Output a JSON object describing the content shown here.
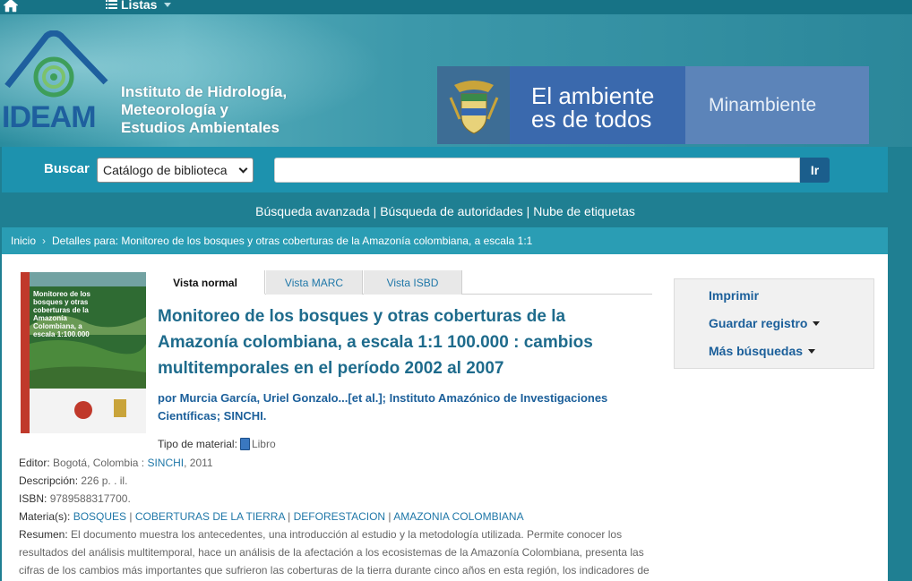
{
  "topbar": {
    "lists_label": "Listas"
  },
  "banner": {
    "logo_text": "IDEAM",
    "institute_lines": [
      "Instituto de Hidrología,",
      "Meteorología y",
      "Estudios Ambientales"
    ],
    "gov_slogan_lines": [
      "El ambiente",
      "es de todos"
    ],
    "ministry": "Minambiente"
  },
  "search": {
    "label": "Buscar",
    "selected_option": "Catálogo de biblioteca",
    "query": "",
    "go_label": "Ir"
  },
  "more_searches": {
    "links": [
      "Búsqueda avanzada",
      "Búsqueda de autoridades",
      "Nube de etiquetas"
    ],
    "separator": " | "
  },
  "breadcrumb": {
    "home": "Inicio",
    "sep": "›",
    "current": "Detalles para: Monitoreo de los bosques y otras coberturas de la Amazonía colombiana, a escala 1:1"
  },
  "cover": {
    "title_lines": [
      "Monitoreo de los",
      "bosques y otras",
      "coberturas de la",
      "Amazonía",
      "Colombiana, a",
      "escala 1:100.000"
    ]
  },
  "tabs": [
    "Vista normal",
    "Vista MARC",
    "Vista ISBD"
  ],
  "record": {
    "title": "Monitoreo de los bosques y otras coberturas de la Amazonía colombiana, a escala 1:1 100.000 : cambios multitemporales en el período 2002 al 2007",
    "authors_prefix": "por ",
    "authors": "Murcia García, Uriel Gonzalo...[et al.]; Instituto Amazónico de Investigaciones Científicas; SINCHI.",
    "material_label": "Tipo de material:",
    "material_value": "Libro",
    "editor_label": "Editor:",
    "editor_place": "Bogotá, Colombia : ",
    "editor_link": "SINCHI",
    "editor_year": ", 2011",
    "description_label": "Descripción:",
    "description_value": "226 p. . il.",
    "isbn_label": "ISBN:",
    "isbn_value": "9789588317700.",
    "subjects_label": "Materia(s):",
    "subjects": [
      "BOSQUES",
      "COBERTURAS DE LA TIERRA",
      "DEFORESTACION",
      "AMAZONIA COLOMBIANA"
    ],
    "summary_label": "Resumen:",
    "summary": "El documento muestra los antecedentes, una introducción al estudio y la metodología utilizada. Permite conocer los resultados del análisis multitemporal, hace un análisis de la afectación a los ecosistemas de la Amazonía Colombiana, presenta las cifras de los cambios más importantes que sufrieron las coberturas de la tierra durante cinco años en esta región, los indicadores de"
  },
  "actions": {
    "print": "Imprimir",
    "save": "Guardar registro",
    "more": "Más búsquedas"
  },
  "colors": {
    "page_bg": "#1f7f92",
    "search_bg": "#1d92ae",
    "breadcrumb_bg": "#2a9db4",
    "title": "#1e6b8c",
    "link": "#1f77a8"
  }
}
